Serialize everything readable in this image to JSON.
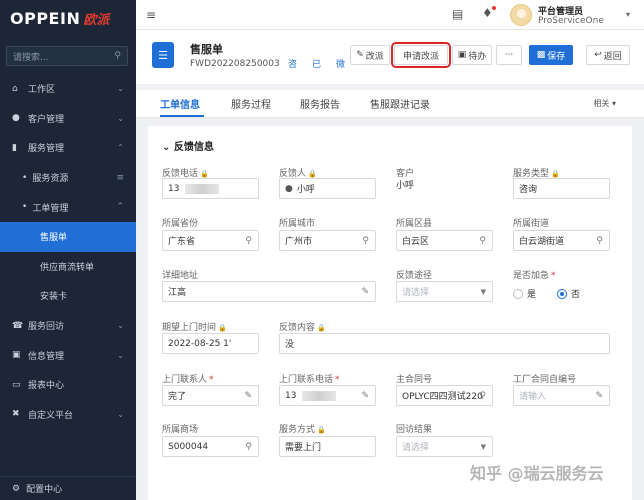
{
  "brand": {
    "logo_en": "OPPEIN",
    "logo_cn": "欧派"
  },
  "sidebar": {
    "search_placeholder": "请搜索...",
    "items": [
      {
        "label": "工作区",
        "icon": "home-icon"
      },
      {
        "label": "客户管理",
        "icon": "user-icon"
      },
      {
        "label": "服务管理",
        "icon": "bookmark-icon"
      },
      {
        "label": "服务资源",
        "icon": "dot"
      },
      {
        "label": "工单管理",
        "icon": "dot"
      },
      {
        "label": "售服单",
        "active": true
      },
      {
        "label": "供应商流转单"
      },
      {
        "label": "安装卡"
      },
      {
        "label": "服务回访",
        "icon": "phone-icon"
      },
      {
        "label": "信息管理",
        "icon": "chat-icon"
      },
      {
        "label": "报表中心",
        "icon": "monitor-icon"
      },
      {
        "label": "自定义平台",
        "icon": "tools-icon"
      }
    ],
    "bottom_label": "配置中心"
  },
  "topbar": {
    "user_name": "平台管理员",
    "user_org": "ProServiceOne"
  },
  "header": {
    "title": "售服单",
    "code": "FWD202208250003",
    "tags": [
      "咨",
      "已",
      "微"
    ],
    "buttons": {
      "change_dispatch": "改派",
      "apply_change": "申请改派",
      "pending": "待办",
      "more": "···",
      "save": "保存",
      "back": "返回"
    }
  },
  "tabs": {
    "items": [
      "工单信息",
      "服务过程",
      "服务报告",
      "售服跟进记录"
    ],
    "related": "相关"
  },
  "form": {
    "section_title": "反馈信息",
    "fields": {
      "feedback_phone": {
        "label": "反馈电话",
        "value": "13"
      },
      "feedback_person": {
        "label": "反馈人",
        "value": "小呼"
      },
      "customer": {
        "label": "客户",
        "value": "小呼"
      },
      "service_type": {
        "label": "服务类型",
        "value": "咨询"
      },
      "province": {
        "label": "所属省份",
        "value": "广东省"
      },
      "city": {
        "label": "所属城市",
        "value": "广州市"
      },
      "district": {
        "label": "所属区县",
        "value": "白云区"
      },
      "street": {
        "label": "所属街道",
        "value": "白云湖街道"
      },
      "address": {
        "label": "详细地址",
        "value": "江高"
      },
      "feedback_channel": {
        "label": "反馈途径",
        "placeholder": "请选择"
      },
      "is_urgent": {
        "label": "是否加急",
        "options": [
          "是",
          "否"
        ],
        "selected": "否"
      },
      "expected_time": {
        "label": "期望上门时间",
        "value": "2022-08-25 1'"
      },
      "feedback_content": {
        "label": "反馈内容",
        "value": "没"
      },
      "contact_person": {
        "label": "上门联系人",
        "value": "完了"
      },
      "contact_phone": {
        "label": "上门联系电话",
        "value": "13"
      },
      "main_contract": {
        "label": "主合同号",
        "value": "OPLYC四四测试220"
      },
      "factory_contract": {
        "label": "工厂合同自编号",
        "placeholder": "请输入"
      },
      "dealer": {
        "label": "所属商场",
        "value": "S000044"
      },
      "service_mode": {
        "label": "服务方式",
        "value": "需要上门"
      },
      "visit_result": {
        "label": "回访结果",
        "placeholder": "请选择"
      }
    }
  },
  "watermark": "知乎 @瑞云服务云"
}
